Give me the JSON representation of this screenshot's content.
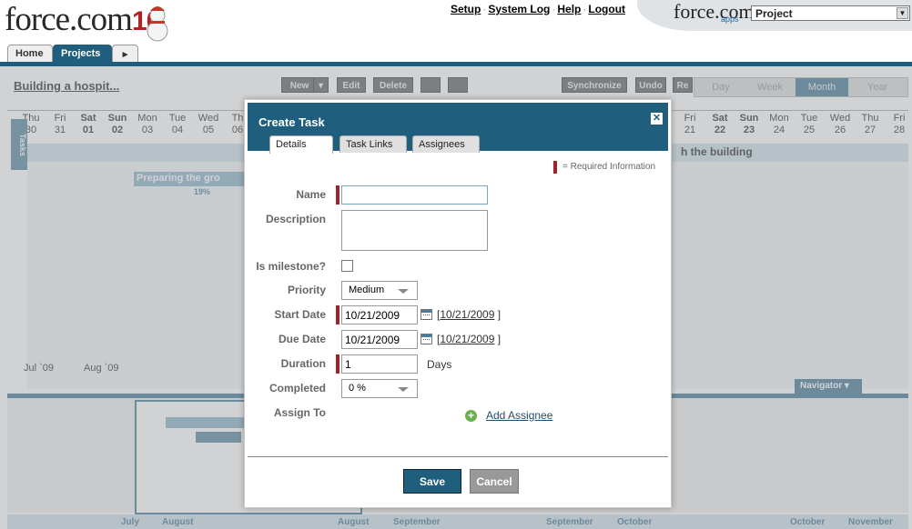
{
  "header": {
    "logo_text": "force.com",
    "logo_ten": "10",
    "links": [
      "Setup",
      "System Log",
      "Help",
      "Logout"
    ],
    "link_sep": "·",
    "apps_logo": "force.com",
    "apps_sub": "apps",
    "app_select_value": "Project"
  },
  "tabs": {
    "home": "Home",
    "projects": "Projects",
    "more": "▸"
  },
  "background": {
    "project_title": "Building a hospit...",
    "toolbar": [
      "New",
      "▾",
      "Edit",
      "Delete",
      "Synchronize",
      "Undo",
      "Re"
    ],
    "view_tabs": [
      "Day",
      "Week",
      "Month",
      "Year"
    ],
    "active_view": "Month",
    "tasks_label": "Tasks",
    "days_left": [
      {
        "name": "Thu",
        "num": "30"
      },
      {
        "name": "Fri",
        "num": "31"
      },
      {
        "name": "Sat",
        "num": "01"
      },
      {
        "name": "Sun",
        "num": "02"
      },
      {
        "name": "Mon",
        "num": "03"
      },
      {
        "name": "Tue",
        "num": "04"
      },
      {
        "name": "Wed",
        "num": "05"
      },
      {
        "name": "Th",
        "num": "06"
      }
    ],
    "days_right": [
      {
        "name": "Fri",
        "num": "21"
      },
      {
        "name": "Sat",
        "num": "22"
      },
      {
        "name": "Sun",
        "num": "23"
      },
      {
        "name": "Mon",
        "num": "24"
      },
      {
        "name": "Tue",
        "num": "25"
      },
      {
        "name": "Wed",
        "num": "26"
      },
      {
        "name": "Thu",
        "num": "27"
      },
      {
        "name": "Fri",
        "num": "28"
      }
    ],
    "build_label": "h the building",
    "task_bar_label": "Preparing the gro",
    "task_pct": "19%",
    "month_labels": [
      "Jul `09",
      "Aug `09"
    ],
    "navigator_label": "Navigator ▾",
    "bottom_axis": [
      "July",
      "August",
      "August",
      "September",
      "September",
      "October",
      "October",
      "November"
    ]
  },
  "dialog": {
    "title": "Create Task",
    "close": "✕",
    "tabs": [
      "Details",
      "Task Links",
      "Assignees"
    ],
    "required_note": "= Required Information",
    "labels": {
      "name": "Name",
      "description": "Description",
      "milestone": "Is milestone?",
      "priority": "Priority",
      "start": "Start Date",
      "due": "Due Date",
      "duration": "Duration",
      "completed": "Completed",
      "assign": "Assign To"
    },
    "fields": {
      "name_value": "",
      "description_value": "",
      "priority_value": "Medium",
      "start_value": "10/21/2009",
      "start_link": "10/21/2009",
      "due_value": "10/21/2009",
      "due_link": "10/21/2009",
      "duration_value": "1",
      "duration_unit": "Days",
      "completed_value": "0 %"
    },
    "add_assignee": "Add Assignee",
    "save": "Save",
    "cancel": "Cancel"
  }
}
